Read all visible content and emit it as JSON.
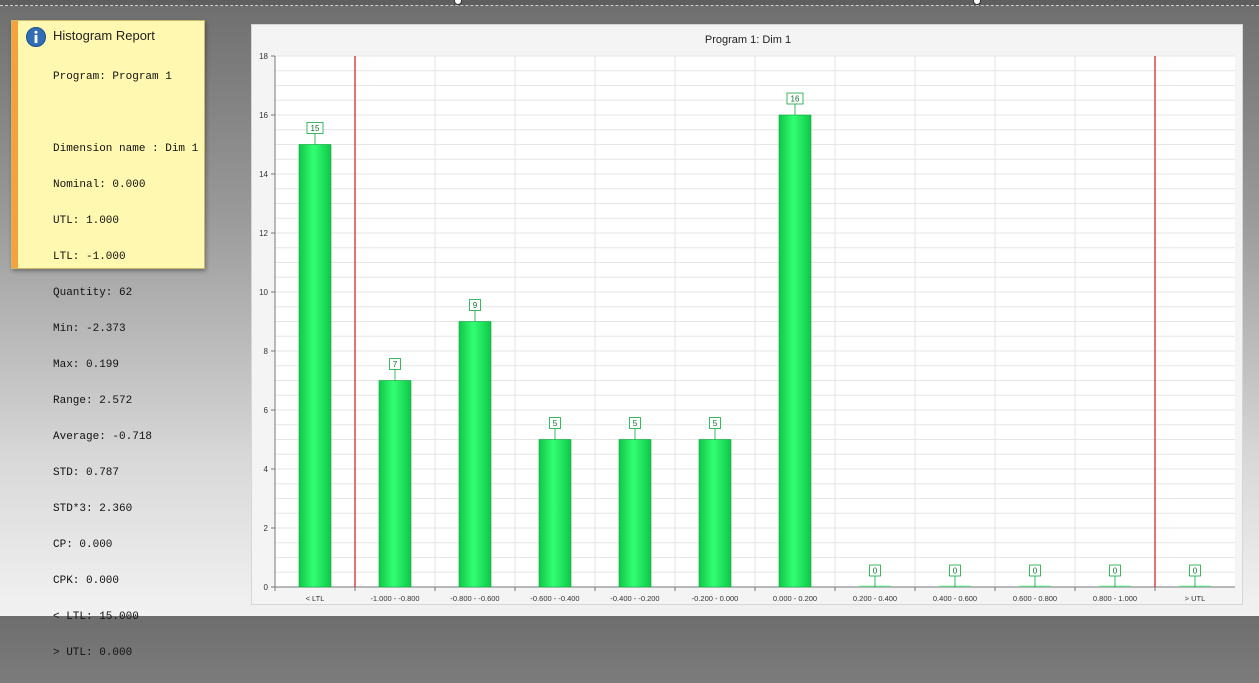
{
  "report": {
    "title": "Histogram Report",
    "program_line": "Program: Program 1",
    "stats": [
      "Dimension name : Dim 1",
      "Nominal: 0.000",
      "UTL: 1.000",
      "LTL: -1.000",
      "Quantity: 62",
      "Min: -2.373",
      "Max: 0.199",
      "Range: 2.572",
      "Average: -0.718",
      "STD: 0.787",
      "STD*3: 2.360",
      "CP: 0.000",
      "CPK: 0.000",
      "< LTL: 15.000",
      "> UTL: 0.000"
    ]
  },
  "colors": {
    "bar": "#1ee85a",
    "bar_edge": "#0aa83a",
    "limit_line": "#d42a2a",
    "note_bg": "#fff8b0",
    "note_accent": "#f4a23c",
    "info_icon": "#2f6db5"
  },
  "chart_data": {
    "type": "bar",
    "title": "Program 1: Dim 1",
    "xlabel": "",
    "ylabel": "",
    "categories": [
      "< LTL",
      "-1.000 - -0.800",
      "-0.800 - -0.600",
      "-0.600 - -0.400",
      "-0.400 - -0.200",
      "-0.200 - 0.000",
      "0.000 - 0.200",
      "0.200 - 0.400",
      "0.400 - 0.600",
      "0.600 - 0.800",
      "0.800 - 1.000",
      "> UTL"
    ],
    "values": [
      15,
      7,
      9,
      5,
      5,
      5,
      16,
      0,
      0,
      0,
      0,
      0
    ],
    "ylim": [
      0,
      18
    ],
    "yticks": [
      0,
      2,
      4,
      6,
      8,
      10,
      12,
      14,
      16,
      18
    ],
    "grid": true,
    "data_labels": true,
    "limit_lines": [
      "LTL",
      "UTL"
    ]
  }
}
